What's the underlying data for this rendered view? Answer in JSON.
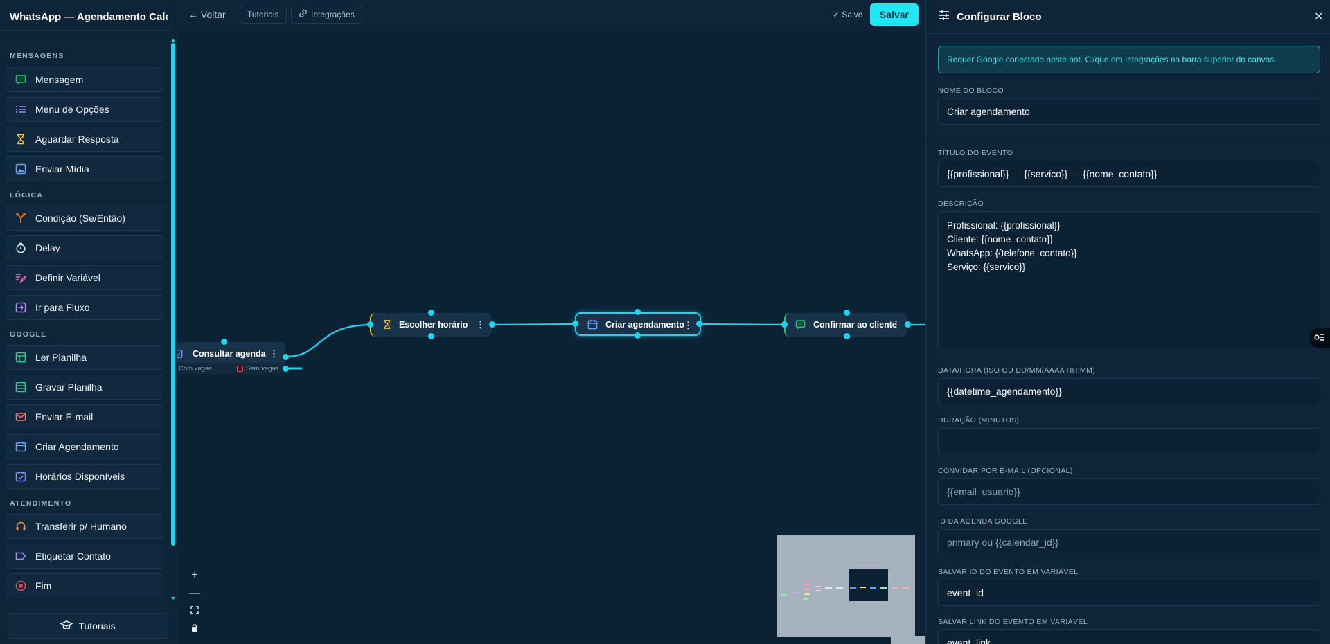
{
  "sidebar": {
    "title": "WhatsApp — Agendamento Calendário",
    "sections": [
      {
        "label": "MENSAGENS",
        "items": [
          {
            "label": "Mensagem",
            "icon": "message-icon",
            "color": "#22c55e"
          },
          {
            "label": "Menu de Opções",
            "icon": "list-icon",
            "color": "#a78bfa"
          },
          {
            "label": "Aguardar Resposta",
            "icon": "hourglass-icon",
            "color": "#facc15"
          },
          {
            "label": "Enviar Mídia",
            "icon": "image-icon",
            "color": "#60a5fa"
          }
        ]
      },
      {
        "label": "LÓGICA",
        "items": [
          {
            "label": "Condição (Se/Então)",
            "icon": "branch-icon",
            "color": "#f97316"
          },
          {
            "label": "Delay",
            "icon": "timer-icon",
            "color": "#e2e8f0"
          },
          {
            "label": "Definir Variável",
            "icon": "edit-variable-icon",
            "color": "#f472b6"
          },
          {
            "label": "Ir para Fluxo",
            "icon": "goto-flow-icon",
            "color": "#c084fc"
          }
        ]
      },
      {
        "label": "GOOGLE",
        "items": [
          {
            "label": "Ler Planilha",
            "icon": "sheet-icon",
            "color": "#34d399"
          },
          {
            "label": "Gravar Planilha",
            "icon": "sheet-write-icon",
            "color": "#34d399"
          },
          {
            "label": "Enviar E-mail",
            "icon": "mail-icon",
            "color": "#f87171"
          },
          {
            "label": "Criar Agendamento",
            "icon": "calendar-icon",
            "color": "#60a5fa"
          },
          {
            "label": "Horários Disponíveis",
            "icon": "calendar-check-icon",
            "color": "#818cf8"
          }
        ]
      },
      {
        "label": "ATENDIMENTO",
        "items": [
          {
            "label": "Transferir p/ Humano",
            "icon": "headset-icon",
            "color": "#fb923c"
          },
          {
            "label": "Etiquetar Contato",
            "icon": "tag-icon",
            "color": "#a78bfa"
          },
          {
            "label": "Fim",
            "icon": "stop-icon",
            "color": "#ef4444"
          }
        ]
      }
    ],
    "tutorials_label": "Tutoriais"
  },
  "topbar": {
    "back_label": "← Voltar",
    "tutorials_label": "Tutoriais",
    "integrations_label": "Integrações",
    "saved_label": "✓ Salvo",
    "save_label": "Salvar"
  },
  "canvas": {
    "nodes": [
      {
        "label": "Consultar agenda",
        "icon": "calendar-check-icon",
        "outputs": [
          "Com vagas",
          "Sem vagas"
        ]
      },
      {
        "label": "Escolher horário",
        "icon": "hourglass-icon"
      },
      {
        "label": "Criar agendamento",
        "icon": "calendar-icon",
        "selected": true
      },
      {
        "label": "Confirmar ao cliente",
        "icon": "message-icon"
      }
    ],
    "accent_color": "#22d3ee"
  },
  "panel": {
    "title": "Configurar Bloco",
    "alert": "Requer Google conectado neste bot. Clique em Integrações na barra superior do canvas.",
    "fields": {
      "block_name": {
        "label": "NOME DO BLOCO",
        "value": "Criar agendamento",
        "placeholder": ""
      },
      "event_title": {
        "label": "TÍTULO DO EVENTO",
        "value": "{{profissional}} — {{servico}} — {{nome_contato}}",
        "placeholder": ""
      },
      "description": {
        "label": "DESCRIÇÃO",
        "value": "Profissional: {{profissional}}\nCliente: {{nome_contato}}\nWhatsApp: {{telefone_contato}}\nServiço: {{servico}}"
      },
      "datetime": {
        "label": "DATA/HORA (ISO OU DD/MM/AAAA HH:MM)",
        "value": "{{datetime_agendamento}}",
        "placeholder": ""
      },
      "duration": {
        "label": "DURAÇÃO (MINUTOS)",
        "value": "",
        "placeholder": ""
      },
      "invite_email": {
        "label": "CONVIDAR POR E-MAIL (OPCIONAL)",
        "value": "",
        "placeholder": "{{email_usuario}}"
      },
      "calendar_id": {
        "label": "ID DA AGENDA GOOGLE",
        "value": "",
        "placeholder": "primary ou {{calendar_id}}"
      },
      "event_id_var": {
        "label": "SALVAR ID DO EVENTO EM VARIÁVEL",
        "value": "event_id",
        "placeholder": ""
      },
      "event_link_var": {
        "label": "SALVAR LINK DO EVENTO EM VARIÁVEL",
        "value": "event_link",
        "placeholder": ""
      }
    }
  }
}
